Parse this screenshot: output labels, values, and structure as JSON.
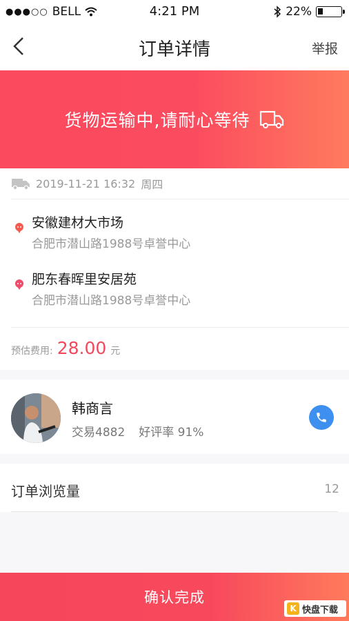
{
  "status_bar": {
    "carrier": "BELL",
    "time": "4:21 PM",
    "battery": "22%",
    "battery_level": 0.22
  },
  "nav": {
    "title": "订单详情",
    "report": "举报"
  },
  "banner": {
    "message": "货物运输中,请耐心等待"
  },
  "order": {
    "datetime": "2019-11-21 16:32",
    "weekday": "周四",
    "origin": {
      "name": "安徽建材大市场",
      "address": "合肥市潜山路1988号卓誉中心"
    },
    "destination": {
      "name": "肥东春晖里安居苑",
      "address": "合肥市潜山路1988号卓誉中心"
    },
    "fee_label": "预估费用:",
    "fee_amount": "28.00",
    "fee_unit": "元"
  },
  "driver": {
    "name": "韩商言",
    "trades": "交易4882",
    "rating": "好评率 91%"
  },
  "views": {
    "label": "订单浏览量",
    "count": "12"
  },
  "confirm": {
    "label": "确认完成"
  },
  "watermark": {
    "text": "快盘下载"
  },
  "colors": {
    "accent": "#f6465c",
    "phone": "#3d8ff0"
  }
}
